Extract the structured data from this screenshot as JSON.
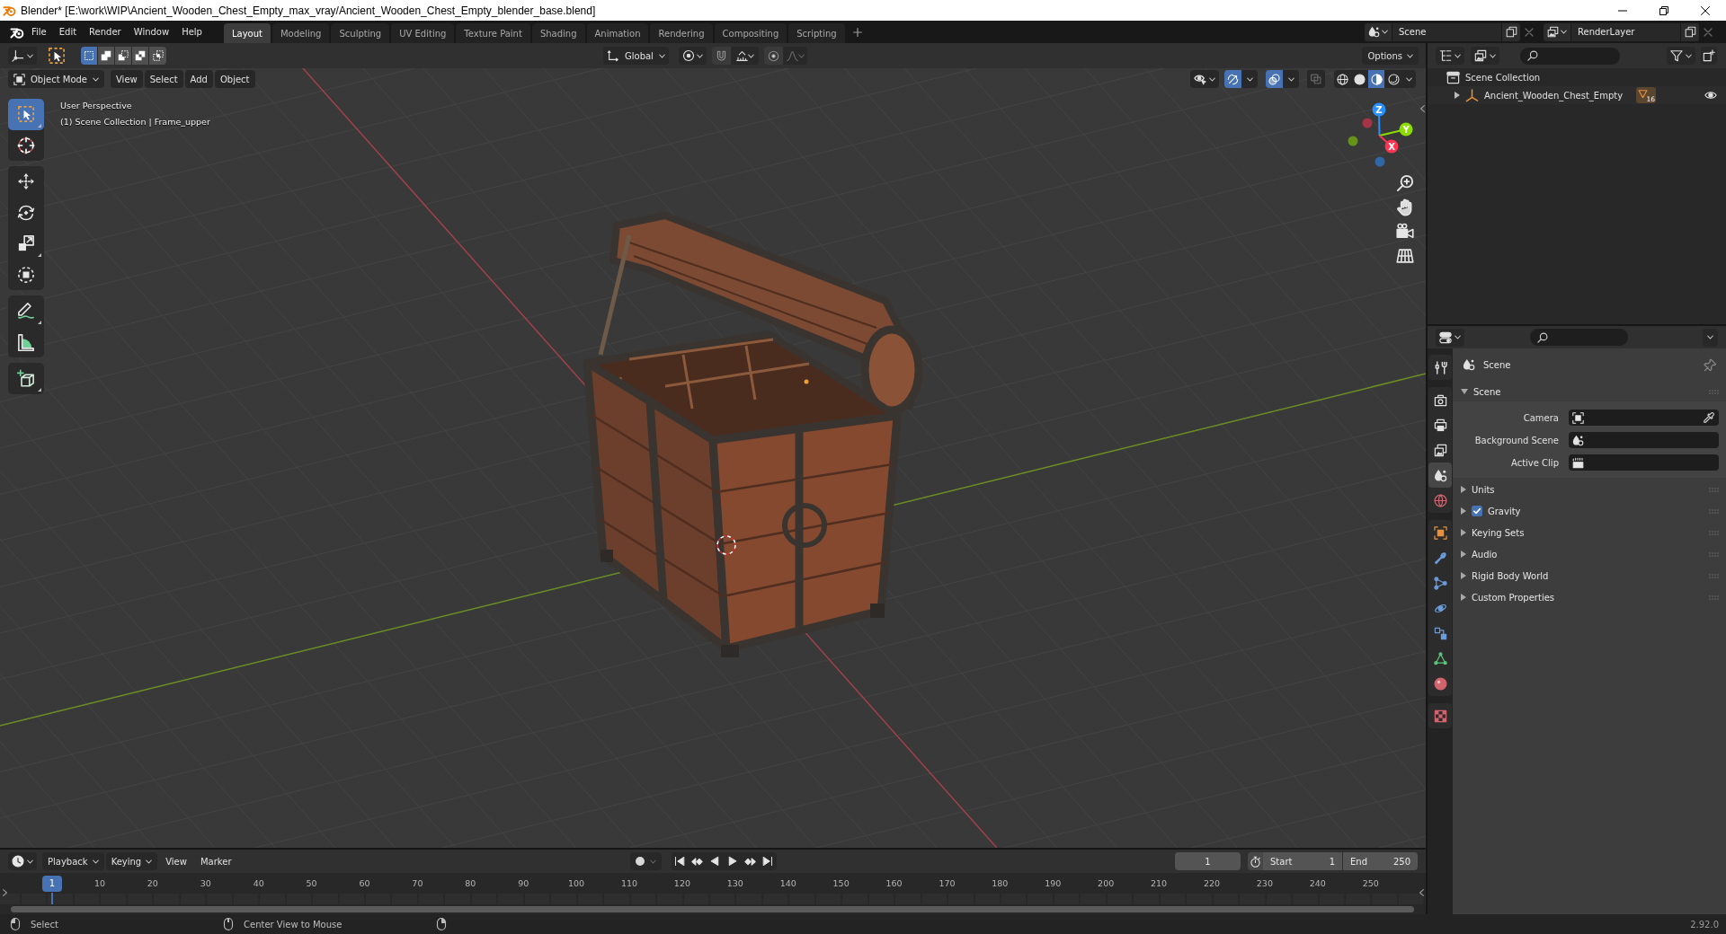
{
  "window": {
    "title": "Blender* [E:\\work\\WIP\\Ancient_Wooden_Chest_Empty_max_vray/Ancient_Wooden_Chest_Empty_blender_base.blend]"
  },
  "menu": [
    "File",
    "Edit",
    "Render",
    "Window",
    "Help"
  ],
  "workspaces": [
    {
      "label": "Layout",
      "selected": true
    },
    {
      "label": "Modeling",
      "selected": false
    },
    {
      "label": "Sculpting",
      "selected": false
    },
    {
      "label": "UV Editing",
      "selected": false
    },
    {
      "label": "Texture Paint",
      "selected": false
    },
    {
      "label": "Shading",
      "selected": false
    },
    {
      "label": "Animation",
      "selected": false
    },
    {
      "label": "Rendering",
      "selected": false
    },
    {
      "label": "Compositing",
      "selected": false
    },
    {
      "label": "Scripting",
      "selected": false
    }
  ],
  "scene_selector": {
    "scene": "Scene",
    "view_layer": "RenderLayer"
  },
  "viewport": {
    "tool_header": {
      "selection_modes": [
        {
          "kind": "set",
          "selected": true
        },
        {
          "kind": "extend",
          "selected": false
        },
        {
          "kind": "subtract",
          "selected": false
        },
        {
          "kind": "difference",
          "selected": false
        },
        {
          "kind": "intersect",
          "selected": false
        }
      ],
      "orientation": "Global",
      "snap": {
        "on": false
      },
      "proportional_editing": {
        "on": false
      },
      "options": "Options"
    },
    "mode": "Object Mode",
    "menus": [
      "View",
      "Select",
      "Add",
      "Object"
    ],
    "toggles": [
      {
        "kind": "gizmos",
        "on": true
      },
      {
        "kind": "overlays",
        "on": true
      },
      {
        "kind": "xray",
        "on": false
      }
    ],
    "shading": [
      {
        "kind": "wireframe",
        "selected": false
      },
      {
        "kind": "solid",
        "selected": false
      },
      {
        "kind": "material",
        "selected": true
      },
      {
        "kind": "rendered",
        "selected": false
      }
    ],
    "tool_groups": [
      [
        {
          "kind": "select",
          "selected": true,
          "variants": true
        },
        {
          "kind": "cursor",
          "selected": false,
          "variants": false
        }
      ],
      [
        {
          "kind": "move",
          "selected": false,
          "variants": false
        },
        {
          "kind": "rotate",
          "selected": false,
          "variants": false
        },
        {
          "kind": "scale",
          "selected": false,
          "variants": true
        },
        {
          "kind": "transform",
          "selected": false,
          "variants": false
        }
      ],
      [
        {
          "kind": "annotate",
          "selected": false,
          "variants": true
        },
        {
          "kind": "measure",
          "selected": false,
          "variants": false
        }
      ],
      [
        {
          "kind": "add",
          "selected": false,
          "variants": true
        }
      ]
    ],
    "info": [
      "User Perspective",
      "(1) Scene Collection | Frame_upper"
    ],
    "gizmo": [
      {
        "label": "Z",
        "color": "#2890ff"
      },
      {
        "label": "Y",
        "color": "#8bdc00"
      },
      {
        "label": "X",
        "color": "#ff3352"
      }
    ]
  },
  "outliner": {
    "items": [
      {
        "label": "Scene Collection",
        "children": [
          {
            "label": "Ancient_Wooden_Chest_Empty",
            "expanded": false,
            "child_count": "16",
            "visible": true
          }
        ]
      }
    ]
  },
  "properties": {
    "tab_groups": [
      [
        {
          "kind": "tool",
          "selected": false
        }
      ],
      [
        {
          "kind": "render",
          "selected": false
        },
        {
          "kind": "output",
          "selected": false
        },
        {
          "kind": "viewlayer",
          "selected": false
        },
        {
          "kind": "scene",
          "selected": true
        },
        {
          "kind": "world",
          "selected": false
        }
      ],
      [
        {
          "kind": "object",
          "selected": false
        },
        {
          "kind": "modifiers",
          "selected": false
        },
        {
          "kind": "particles",
          "selected": false
        },
        {
          "kind": "physics",
          "selected": false
        },
        {
          "kind": "constraints",
          "selected": false
        },
        {
          "kind": "data",
          "selected": false
        },
        {
          "kind": "material",
          "selected": false
        }
      ],
      [
        {
          "kind": "texture",
          "selected": false
        }
      ]
    ],
    "context": "Scene",
    "panels": [
      {
        "title": "Scene",
        "kind": "plain",
        "expanded": true,
        "fields": [
          {
            "kind": "camera",
            "label": "Camera"
          },
          {
            "kind": "scene",
            "label": "Background Scene"
          },
          {
            "kind": "clip",
            "label": "Active Clip"
          }
        ]
      },
      {
        "title": "Units",
        "kind": "plain",
        "expanded": false
      },
      {
        "title": "Gravity",
        "kind": "toggle",
        "checked": true,
        "expanded": false
      },
      {
        "title": "Keying Sets",
        "kind": "plain",
        "expanded": false
      },
      {
        "title": "Audio",
        "kind": "plain",
        "expanded": false
      },
      {
        "title": "Rigid Body World",
        "kind": "plain",
        "expanded": false
      },
      {
        "title": "Custom Properties",
        "kind": "plain",
        "expanded": false
      }
    ]
  },
  "timeline": {
    "menus": [
      {
        "label": "Playback",
        "kind": "dropdown"
      },
      {
        "label": "Keying",
        "kind": "dropdown"
      },
      {
        "label": "View",
        "kind": "menu"
      },
      {
        "label": "Marker",
        "kind": "menu"
      }
    ],
    "current_frame": "1",
    "start": {
      "label": "Start",
      "value": "1"
    },
    "end": {
      "label": "End",
      "value": "250"
    },
    "ruler": {
      "playhead": "1",
      "ticks": [
        "10",
        "20",
        "30",
        "40",
        "50",
        "60",
        "70",
        "80",
        "90",
        "100",
        "110",
        "120",
        "130",
        "140",
        "150",
        "160",
        "170",
        "180",
        "190",
        "200",
        "210",
        "220",
        "230",
        "240",
        "250"
      ]
    }
  },
  "status_bar": {
    "hints": [
      {
        "kind": "left",
        "label": "Select"
      },
      {
        "kind": "middle",
        "label": "Center View to Mouse"
      },
      {
        "kind": "right"
      }
    ],
    "version": "2.92.0"
  }
}
